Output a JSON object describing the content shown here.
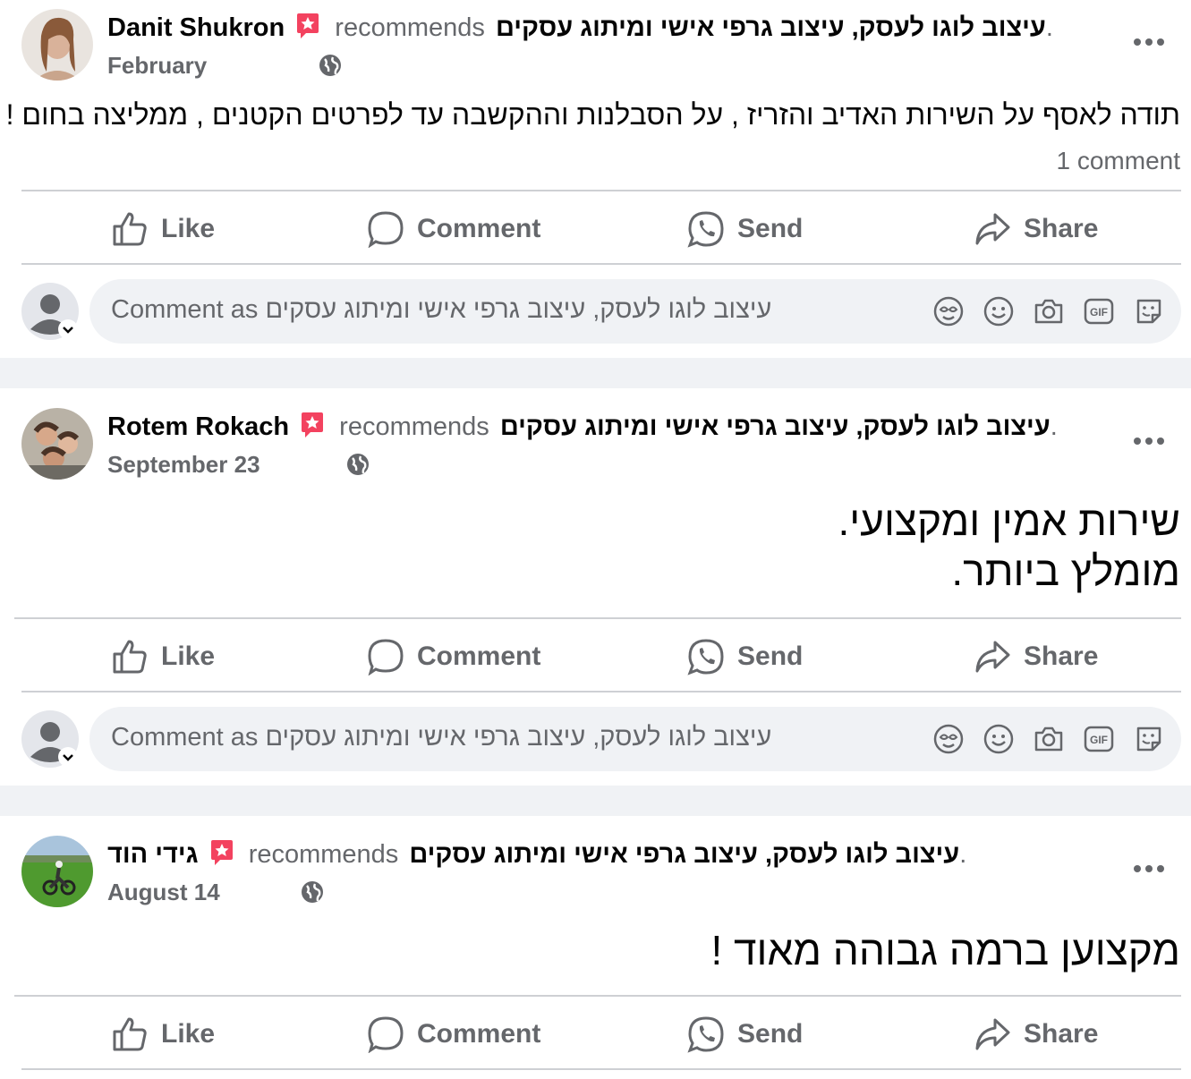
{
  "common": {
    "recommends": "recommends",
    "page_name": "עיצוב לוגו לעסק, עיצוב גרפי אישי ומיתוג עסקים",
    "page_suffix": ".",
    "comment_placeholder": "Comment as עיצוב לוגו לעסק, עיצוב גרפי אישי ומיתוג עסקים",
    "actions": {
      "like": "Like",
      "comment": "Comment",
      "send": "Send",
      "share": "Share"
    },
    "icons": [
      "like-icon",
      "comment-icon",
      "send-icon",
      "share-icon",
      "globe-icon",
      "more-icon",
      "recommend-badge-icon",
      "avatar-icon",
      "emoji-icon",
      "camera-icon",
      "gif-icon",
      "sticker-icon",
      "avatar-emoji-icon"
    ],
    "colors": {
      "background": "#f0f2f5",
      "badge": "#f3425f",
      "secondary_text": "#65676b",
      "divider": "#ced0d4"
    }
  },
  "posts": [
    {
      "author": "Danit Shukron",
      "date": "February",
      "text": "תודה לאסף על השירות האדיב והזריז , על הסבלנות וההקשבה עד לפרטים הקטנים  , ממליצה בחום !",
      "comments_count": "1 comment"
    },
    {
      "author": "Rotem Rokach",
      "date": "September 23",
      "text_line1": "שירות אמין ומקצועי.",
      "text_line2": "מומלץ ביותר."
    },
    {
      "author": "גידי הוד",
      "date": "August 14",
      "text": "מקצוען ברמה גבוהה מאוד !"
    }
  ]
}
